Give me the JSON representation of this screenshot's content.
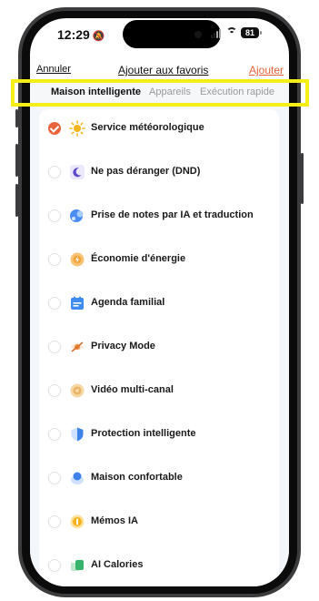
{
  "status_bar": {
    "time": "12:29",
    "battery": "81"
  },
  "nav": {
    "cancel_label": "Annuler",
    "title": "Ajouter aux favoris",
    "add_label": "Ajouter"
  },
  "tabs": [
    {
      "label": "Maison intelligente",
      "active": true
    },
    {
      "label": "Appareils",
      "active": false
    },
    {
      "label": "Exécution rapide",
      "active": false
    }
  ],
  "colors": {
    "accent": "#e8633b",
    "highlight": "#f6ee18",
    "background": "#f3f6fb"
  },
  "items": [
    {
      "label": "Service météorologique",
      "checked": true,
      "icon": "sun-icon"
    },
    {
      "label": "Ne pas déranger (DND)",
      "checked": false,
      "icon": "moon-icon"
    },
    {
      "label": "Prise de notes par IA et traduction",
      "checked": false,
      "icon": "notes-translate-icon"
    },
    {
      "label": "Économie d'énergie",
      "checked": false,
      "icon": "energy-saving-icon"
    },
    {
      "label": "Agenda familial",
      "checked": false,
      "icon": "calendar-icon"
    },
    {
      "label": "Privacy Mode",
      "checked": false,
      "icon": "privacy-eye-icon"
    },
    {
      "label": "Vidéo multi-canal",
      "checked": false,
      "icon": "multi-video-icon"
    },
    {
      "label": "Protection intelligente",
      "checked": false,
      "icon": "shield-icon"
    },
    {
      "label": "Maison confortable",
      "checked": false,
      "icon": "comfort-home-icon"
    },
    {
      "label": "Mémos IA",
      "checked": false,
      "icon": "memo-icon"
    },
    {
      "label": "AI Calories",
      "checked": false,
      "icon": "calories-icon"
    }
  ]
}
